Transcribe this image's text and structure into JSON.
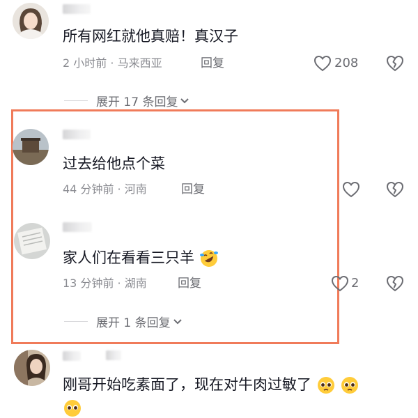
{
  "comments": [
    {
      "text": "所有网红就他真赔！真汉子",
      "time": "2 小时前",
      "location": "马来西亚",
      "reply": "回复",
      "likes": "208"
    },
    {
      "text": "过去给他点个菜",
      "time": "44 分钟前",
      "location": "河南",
      "reply": "回复"
    },
    {
      "text": "家人们在看看三只羊",
      "time": "13 分钟前",
      "location": "湖南",
      "reply": "回复",
      "likes": "2"
    },
    {
      "text": "刚哥开始吃素面了，现在对牛肉过敏了"
    }
  ],
  "expand1": "展开 17 条回复",
  "expand2": "展开 1 条回复",
  "separator": "·",
  "colors": {
    "highlight_border": "#f07b5a",
    "meta": "#8a8b91",
    "text": "#161823"
  },
  "icons": [
    "heart-icon",
    "broken-heart-icon",
    "chevron-down-icon",
    "laughing-crying-emoji",
    "pleading-emoji"
  ]
}
